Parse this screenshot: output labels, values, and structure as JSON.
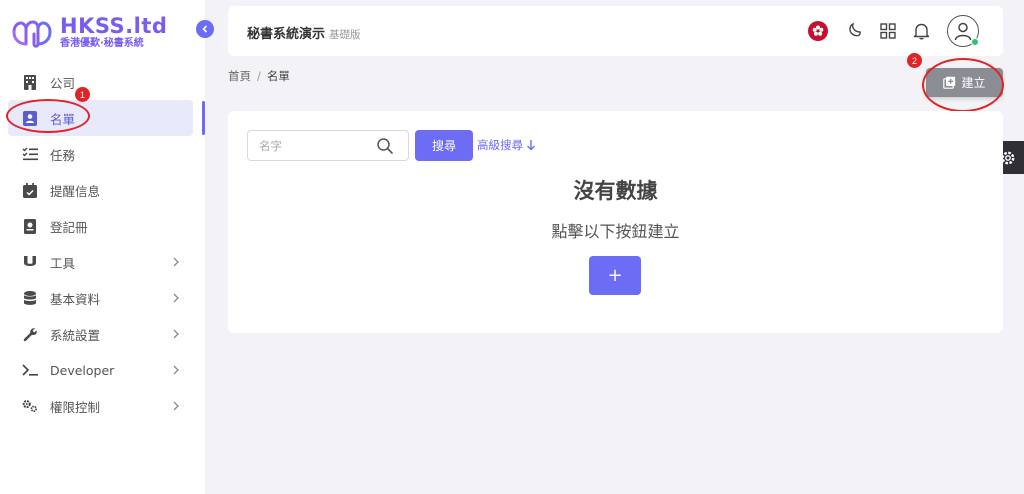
{
  "brand": {
    "name": "HKSS.ltd",
    "tagline": "香港優歎·秘書系統"
  },
  "colors": {
    "accent": "#6c6cf5",
    "annotation": "#e02424",
    "online": "#28c76f"
  },
  "sidebar": {
    "items": [
      {
        "label": "公司",
        "icon": "building-icon"
      },
      {
        "label": "名單",
        "icon": "contact-card-icon",
        "active": true
      },
      {
        "label": "任務",
        "icon": "task-list-icon"
      },
      {
        "label": "提醒信息",
        "icon": "calendar-check-icon"
      },
      {
        "label": "登記冊",
        "icon": "register-book-icon"
      },
      {
        "label": "工具",
        "icon": "magnet-icon",
        "expandable": true
      },
      {
        "label": "基本資料",
        "icon": "database-icon",
        "expandable": true
      },
      {
        "label": "系統設置",
        "icon": "wrench-icon",
        "expandable": true
      },
      {
        "label": "Developer",
        "icon": "terminal-icon",
        "expandable": true
      },
      {
        "label": "權限控制",
        "icon": "gears-icon",
        "expandable": true
      }
    ]
  },
  "header": {
    "title": "秘書系統演示",
    "edition": "基礎版",
    "icons": [
      "hk-flag-icon",
      "moon-icon",
      "grid-icon",
      "bell-icon",
      "user-avatar-icon"
    ]
  },
  "breadcrumb": {
    "home": "首頁",
    "separator": "/",
    "current": "名單"
  },
  "toolbar": {
    "create_label": "建立"
  },
  "search": {
    "placeholder": "名字",
    "value": "",
    "button_label": "搜尋",
    "advanced_label": "高級搜尋"
  },
  "empty_state": {
    "title": "沒有數據",
    "subtitle": "點擊以下按鈕建立",
    "add_label": "+"
  },
  "annotations": [
    {
      "number": "1",
      "target": "名單"
    },
    {
      "number": "2",
      "target": "建立"
    }
  ]
}
